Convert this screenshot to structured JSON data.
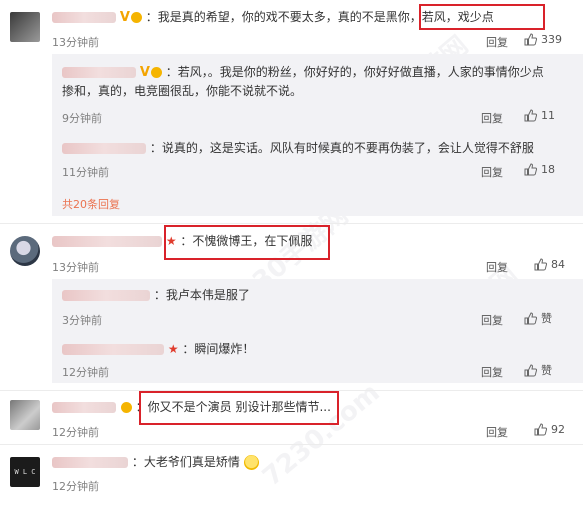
{
  "comments": [
    {
      "text": "：我是真的希望，你的戏不要太多，真的不是黑你，若风，戏少点",
      "time": "13分钟前",
      "reply_label": "回复",
      "likes": "339",
      "replies": [
        {
          "text": "：若风，。我是你的粉丝，你好好的，你好好做直播，人家的事情你少点",
          "text2": "掺和，真的，电竞圈很乱，你能不说就不说。",
          "time": "9分钟前",
          "reply_label": "回复",
          "likes": "11"
        },
        {
          "text": "：说真的，这是实话。风队有时候真的不要再伪装了，会让人觉得不舒服",
          "time": "11分钟前",
          "reply_label": "回复",
          "likes": "18"
        }
      ],
      "more": "共20条回复"
    },
    {
      "text": "：不愧微博王，在下佩服",
      "time": "13分钟前",
      "reply_label": "回复",
      "likes": "84",
      "replies": [
        {
          "text": "：我卢本伟是服了",
          "time": "3分钟前",
          "reply_label": "回复",
          "likes": "赞"
        },
        {
          "text": "：瞬间爆炸！",
          "time": "12分钟前",
          "reply_label": "回复",
          "likes": "赞"
        }
      ]
    },
    {
      "text": "：你又不是个演员 别设计那些情节...",
      "time": "12分钟前",
      "reply_label": "回复",
      "likes": "92"
    },
    {
      "text": "：大老爷们真是矫情",
      "time": "12分钟前",
      "reply_label": "回复",
      "likes": ""
    }
  ],
  "avatar_text": "W L C",
  "watermark": "7230手游网",
  "watermark_domain": "7230.com",
  "colors": {
    "highlight_box": "#d9222a",
    "link": "#eb7350",
    "sub_bg": "#f2f2f5"
  }
}
